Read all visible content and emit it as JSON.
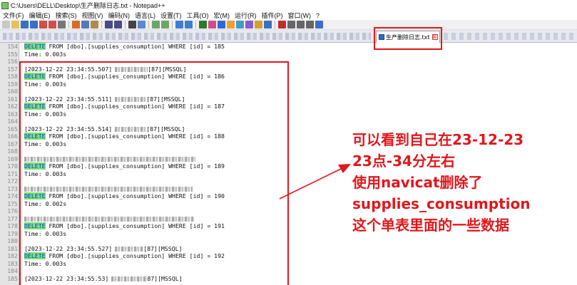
{
  "window": {
    "title": "C:\\Users\\DELL\\Desktop\\生产删除日志.txt - Notepad++"
  },
  "menu": [
    "文件(F)",
    "编辑(E)",
    "搜索(S)",
    "视图(V)",
    "编码(N)",
    "语言(L)",
    "设置(T)",
    "工具(O)",
    "宏(M)",
    "运行(R)",
    "插件(P)",
    "窗口(W)",
    "?"
  ],
  "tab": {
    "label": "生产删除日志.txt",
    "close_glyph": "⊠"
  },
  "lines": [
    {
      "n": "154",
      "kw": "DELETE",
      "text": " FROM [dbo].[supplies_consumption] WHERE [id] = 185"
    },
    {
      "n": "155",
      "text": "Time: 0.003s"
    },
    {
      "n": "156",
      "text": ""
    },
    {
      "n": "157",
      "text": "[2023-12-22 23:34:55.507]",
      "blur": 46,
      "tail": "[87][MSSQL]"
    },
    {
      "n": "158",
      "kw": "DELETE",
      "text": " FROM [dbo].[supplies_consumption] WHERE [id] = 186"
    },
    {
      "n": "159",
      "text": "Time: 0.003s"
    },
    {
      "n": "160",
      "text": ""
    },
    {
      "n": "161",
      "text": "[2023-12-22 23:34:55.511]",
      "blur": 44,
      "tail": "[87][MSSQL]"
    },
    {
      "n": "162",
      "kw": "DELETE",
      "text": " FROM [dbo].[supplies_consumption] WHERE [id] = 187"
    },
    {
      "n": "163",
      "text": "Time: 0.003s"
    },
    {
      "n": "164",
      "text": ""
    },
    {
      "n": "165",
      "text": "[2023-12-22 23:34:55.514]",
      "blur": 44,
      "tail": "[87][MSSQL]"
    },
    {
      "n": "166",
      "kw": "DELETE",
      "text": " FROM [dbo].[supplies_consumption] WHERE [id] = 188"
    },
    {
      "n": "167",
      "text": "Time: 0.003s"
    },
    {
      "n": "168",
      "text": ""
    },
    {
      "n": "169",
      "text": "",
      "blur": 240
    },
    {
      "n": "170",
      "kw": "DELETE",
      "text": " FROM [dbo].[supplies_consumption] WHERE [id] = 189"
    },
    {
      "n": "171",
      "text": "Time: 0.003s"
    },
    {
      "n": "172",
      "text": ""
    },
    {
      "n": "173",
      "text": "",
      "blur": 236
    },
    {
      "n": "174",
      "kw": "DELETE",
      "text": " FROM [dbo].[supplies_consumption] WHERE [id] = 190"
    },
    {
      "n": "175",
      "text": "Time: 0.002s"
    },
    {
      "n": "176",
      "text": ""
    },
    {
      "n": "177",
      "text": "",
      "blur": 238
    },
    {
      "n": "178",
      "kw": "DELETE",
      "text": " FROM [dbo].[supplies_consumption] WHERE [id] = 191"
    },
    {
      "n": "179",
      "text": "Time: 0.003s"
    },
    {
      "n": "180",
      "text": ""
    },
    {
      "n": "181",
      "text": "[2023-12-22 23:34:55.527]",
      "blur": 40,
      "tail": "[87][MSSQL]"
    },
    {
      "n": "182",
      "kw": "DELETE",
      "text": " FROM [dbo].[supplies_consumption] WHERE [id] = 192"
    },
    {
      "n": "183",
      "text": "Time: 0.003s"
    },
    {
      "n": "184",
      "text": ""
    },
    {
      "n": "185",
      "text": "[2023-12-22 23:34:55.53]",
      "blur": 50,
      "tail": "87][MSSQL]"
    }
  ],
  "annotation": [
    "可以看到自己在23-12-23",
    "23点-34分左右",
    "使用navicat删除了",
    "supplies_consumption",
    "这个单表里面的一些数据"
  ],
  "colors": {
    "annotation": "#e0171c",
    "keyword_bg": "#7de07d",
    "keyword_fg": "#0040c0"
  }
}
